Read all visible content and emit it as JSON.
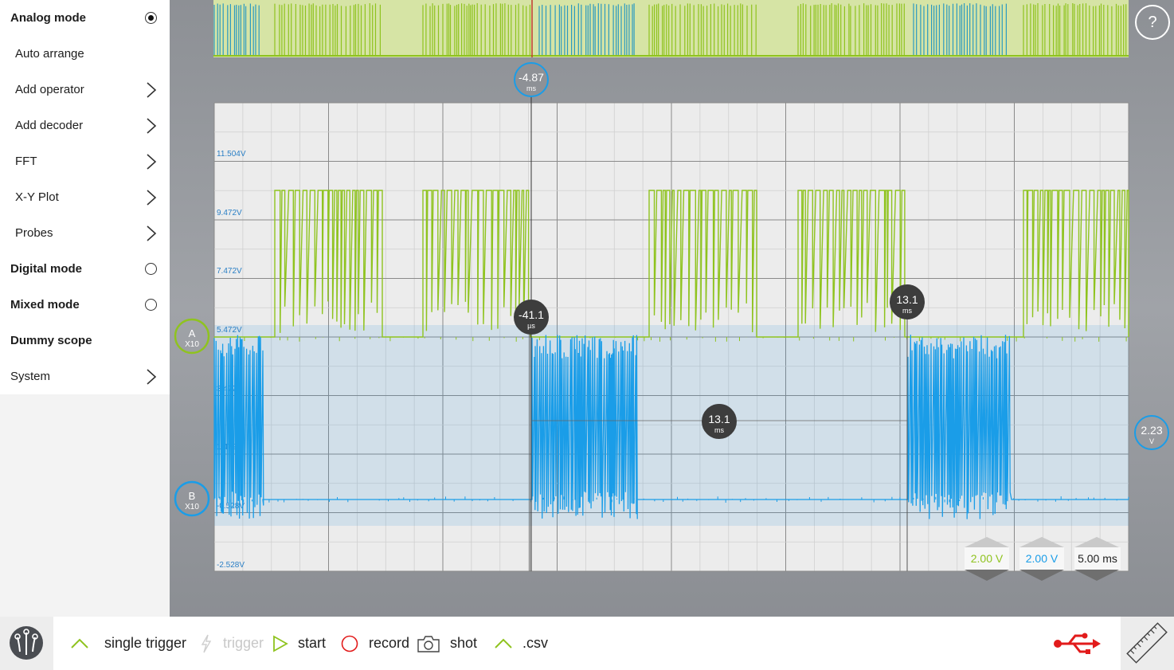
{
  "menu": {
    "analog_mode": "Analog mode",
    "auto_arrange": "Auto arrange",
    "add_operator": "Add operator",
    "add_decoder": "Add decoder",
    "fft": "FFT",
    "xy_plot": "X-Y Plot",
    "probes": "Probes",
    "digital_mode": "Digital mode",
    "mixed_mode": "Mixed mode",
    "dummy_scope": "Dummy scope",
    "system": "System",
    "selected_mode": "Analog mode"
  },
  "help_label": "?",
  "markers": {
    "time_cursor": {
      "value": "-4.87",
      "unit": "ms"
    },
    "trigger_cursor": {
      "value": "-41.1",
      "unit": "µs"
    },
    "cursor_b": {
      "value": "13.1",
      "unit": "ms"
    },
    "delta": {
      "value": "13.1",
      "unit": "ms"
    },
    "level": {
      "value": "2.23",
      "unit": "V"
    }
  },
  "channels": {
    "a": {
      "name": "A",
      "probe": "X10",
      "color": "#8fc31f"
    },
    "b": {
      "name": "B",
      "probe": "X10",
      "color": "#1a9de8"
    }
  },
  "y_ticks": [
    "11.504V",
    "9.472V",
    "7.472V",
    "5.472V",
    "3.472V",
    "1.472V",
    "-0.528V",
    "-2.528V"
  ],
  "scales": {
    "ch_a": "2.00 V",
    "ch_b": "2.00 V",
    "time": "5.00 ms"
  },
  "toolbar": {
    "single_trigger": "single trigger",
    "trigger": "trigger",
    "start": "start",
    "record": "record",
    "shot": "shot",
    "csv": ".csv"
  },
  "icons": {
    "logo": "scoppy-logo-icon",
    "usb": "usb-icon",
    "ruler": "ruler-icon"
  }
}
